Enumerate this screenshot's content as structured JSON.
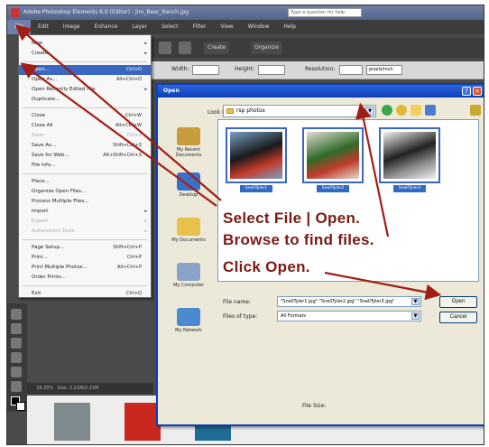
{
  "app": {
    "title": "Adobe Photoshop Elements 6.0 (Editor) - Jim_Bear_Ranch.jpg",
    "menus": [
      "File",
      "Edit",
      "Image",
      "Enhance",
      "Layer",
      "Select",
      "Filter",
      "View",
      "Window",
      "Help"
    ],
    "active_menu": "File",
    "help_search_placeholder": "Type a question for help",
    "toolbar": {
      "create_label": "Create",
      "organize_label": "Organize"
    },
    "options_bar": {
      "width_label": "Width:",
      "height_label": "Height:",
      "resolution_label": "Resolution:",
      "resolution_unit": "pixels/inch"
    },
    "status_text": "33.33%",
    "status_doc": "Doc: 2.21M/2.21M"
  },
  "file_menu": {
    "items": [
      {
        "label": "New",
        "shortcut": "",
        "arrow": "▸",
        "disabled": false,
        "highlight": false
      },
      {
        "label": "Create",
        "shortcut": "",
        "arrow": "▸",
        "disabled": false,
        "highlight": false
      },
      {
        "label": "Open...",
        "shortcut": "Ctrl+O",
        "arrow": "",
        "disabled": false,
        "highlight": true
      },
      {
        "label": "Open As...",
        "shortcut": "Alt+Ctrl+O",
        "arrow": "",
        "disabled": false,
        "highlight": false
      },
      {
        "label": "Open Recently Edited File",
        "shortcut": "",
        "arrow": "▸",
        "disabled": false,
        "highlight": false
      },
      {
        "label": "Duplicate...",
        "shortcut": "",
        "arrow": "",
        "disabled": false,
        "highlight": false
      },
      {
        "label": "Close",
        "shortcut": "Ctrl+W",
        "arrow": "",
        "disabled": false,
        "highlight": false
      },
      {
        "label": "Close All",
        "shortcut": "Alt+Ctrl+W",
        "arrow": "",
        "disabled": false,
        "highlight": false
      },
      {
        "label": "Save",
        "shortcut": "Ctrl+S",
        "arrow": "",
        "disabled": true,
        "highlight": false
      },
      {
        "label": "Save As...",
        "shortcut": "Shift+Ctrl+S",
        "arrow": "",
        "disabled": false,
        "highlight": false
      },
      {
        "label": "Save for Web...",
        "shortcut": "Alt+Shift+Ctrl+S",
        "arrow": "",
        "disabled": false,
        "highlight": false
      },
      {
        "label": "File Info...",
        "shortcut": "",
        "arrow": "",
        "disabled": false,
        "highlight": false
      },
      {
        "label": "Place...",
        "shortcut": "",
        "arrow": "",
        "disabled": false,
        "highlight": false
      },
      {
        "label": "Organize Open Files...",
        "shortcut": "",
        "arrow": "",
        "disabled": false,
        "highlight": false
      },
      {
        "label": "Process Multiple Files...",
        "shortcut": "",
        "arrow": "",
        "disabled": false,
        "highlight": false
      },
      {
        "label": "Import",
        "shortcut": "",
        "arrow": "▸",
        "disabled": false,
        "highlight": false
      },
      {
        "label": "Export",
        "shortcut": "",
        "arrow": "▸",
        "disabled": true,
        "highlight": false
      },
      {
        "label": "Automation Tools",
        "shortcut": "",
        "arrow": "▸",
        "disabled": true,
        "highlight": false
      },
      {
        "label": "Page Setup...",
        "shortcut": "Shift+Ctrl+P",
        "arrow": "",
        "disabled": false,
        "highlight": false
      },
      {
        "label": "Print...",
        "shortcut": "Ctrl+P",
        "arrow": "",
        "disabled": false,
        "highlight": false
      },
      {
        "label": "Print Multiple Photos...",
        "shortcut": "Alt+Ctrl+P",
        "arrow": "",
        "disabled": false,
        "highlight": false
      },
      {
        "label": "Order Prints...",
        "shortcut": "",
        "arrow": "",
        "disabled": false,
        "highlight": false
      },
      {
        "label": "Exit",
        "shortcut": "Ctrl+Q",
        "arrow": "",
        "disabled": false,
        "highlight": false
      }
    ]
  },
  "open_dialog": {
    "title": "Open",
    "look_in_label": "Look in:",
    "look_in_value": "rsp photos",
    "places": [
      {
        "label": "My Recent Documents",
        "color": "#c89b3c"
      },
      {
        "label": "Desktop",
        "color": "#3a70c8"
      },
      {
        "label": "My Documents",
        "color": "#e6c24a"
      },
      {
        "label": "My Computer",
        "color": "#8aa3c8"
      },
      {
        "label": "My Network",
        "color": "#4a8ad0"
      }
    ],
    "files": [
      {
        "name": "SnellTyler1",
        "colors": [
          "#1a1a1a",
          "#c23a2a",
          "#7aa0c8"
        ]
      },
      {
        "name": "SnellTyler2",
        "colors": [
          "#2f6b2a",
          "#c23a2a",
          "#e0dcd0"
        ]
      },
      {
        "name": "SnellTyler3",
        "colors": [
          "#222222",
          "#8a8a8a",
          "#f0f0f0"
        ]
      }
    ],
    "file_name_label": "File name:",
    "file_name_value": "\"SnellTyler1.jpg\" \"SnellTyler2.jpg\" \"SnellTyler3.jpg\"",
    "files_of_type_label": "Files of type:",
    "files_of_type_value": "All Formats",
    "open_button": "Open",
    "cancel_button": "Cancel",
    "file_size_label": "File Size:"
  },
  "bin_thumbs": [
    {
      "color": "#7f8a8e"
    },
    {
      "color": "#c8281e"
    },
    {
      "color": "#1f6d94"
    }
  ],
  "annotations": {
    "line1": "Select File | Open.",
    "line2": "Browse to find files.",
    "line3": "Click Open.",
    "arrow_color": "#a01e14",
    "text_color": "#7a1a12"
  }
}
